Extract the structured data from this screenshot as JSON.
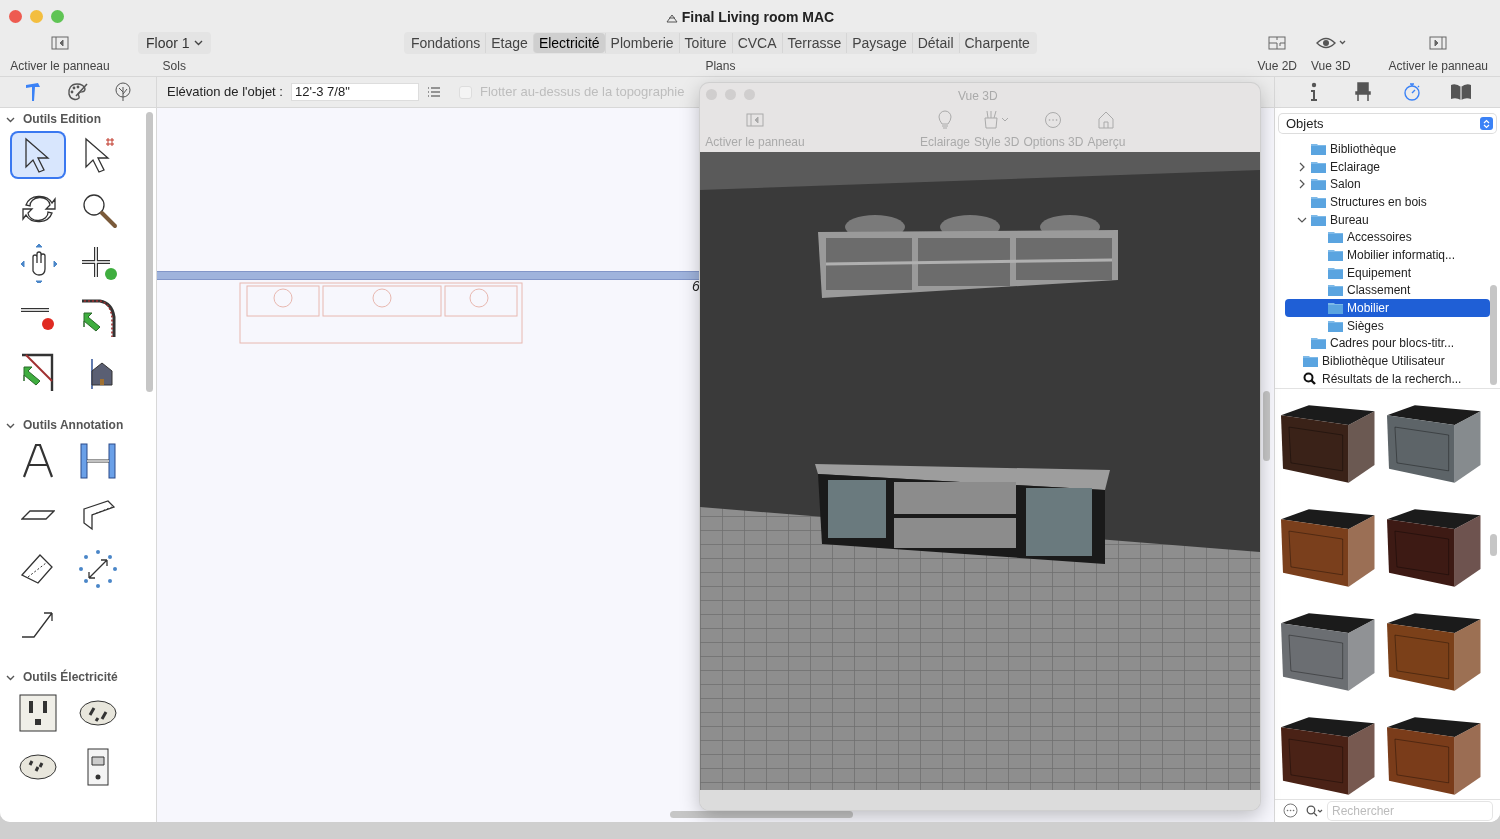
{
  "window": {
    "title": "Final Living room MAC"
  },
  "toolbar": {
    "left_button": "Activer le panneau",
    "floor": {
      "value": "Floor 1",
      "label": "Sols"
    },
    "plans_label": "Plans",
    "plans": [
      {
        "label": "Fondations",
        "selected": false
      },
      {
        "label": "Etage",
        "selected": false
      },
      {
        "label": "Electricité",
        "selected": true
      },
      {
        "label": "Plomberie",
        "selected": false
      },
      {
        "label": "Toiture",
        "selected": false
      },
      {
        "label": "CVCA",
        "selected": false
      },
      {
        "label": "Terrasse",
        "selected": false
      },
      {
        "label": "Paysage",
        "selected": false
      },
      {
        "label": "Détail",
        "selected": false
      },
      {
        "label": "Charpente",
        "selected": false
      }
    ],
    "right_buttons": [
      {
        "kind": "plan",
        "label": "Vue 2D"
      },
      {
        "kind": "eye",
        "label": "Vue 3D"
      },
      {
        "kind": "panel",
        "label": "Activer le panneau"
      }
    ]
  },
  "palette": {
    "tabs": [
      {
        "kind": "hammer",
        "selected": true
      },
      {
        "kind": "palette",
        "selected": false
      },
      {
        "kind": "tree",
        "selected": false
      }
    ],
    "sections": [
      {
        "title": "Outils Edition",
        "expanded": true,
        "tools": [
          {
            "kind": "select",
            "selected": true
          },
          {
            "kind": "select-hash",
            "selected": false
          },
          {
            "kind": "rotate",
            "selected": false
          },
          {
            "kind": "zoom",
            "selected": false
          },
          {
            "kind": "pan",
            "selected": false
          },
          {
            "kind": "add-point",
            "selected": false
          },
          {
            "kind": "remove-point",
            "selected": false
          },
          {
            "kind": "arc-corner",
            "selected": false
          },
          {
            "kind": "diag-corner",
            "selected": false
          },
          {
            "kind": "house",
            "selected": false
          }
        ]
      },
      {
        "title": "Outils Annotation",
        "expanded": true,
        "tools": [
          {
            "kind": "text",
            "selected": false
          },
          {
            "kind": "dimension",
            "selected": false
          },
          {
            "kind": "dim-line",
            "selected": false
          },
          {
            "kind": "dim-box",
            "selected": false
          },
          {
            "kind": "dim-angle",
            "selected": false
          },
          {
            "kind": "dim-circle",
            "selected": false
          },
          {
            "kind": "arrow",
            "selected": false
          }
        ]
      },
      {
        "title": "Outils Électricité",
        "expanded": true,
        "tools": [
          {
            "kind": "outlet",
            "selected": false
          },
          {
            "kind": "round-outlet",
            "selected": false
          },
          {
            "kind": "round-outlet-2",
            "selected": false
          },
          {
            "kind": "switch",
            "selected": false
          }
        ]
      }
    ]
  },
  "properties": {
    "elevation_label": "Elévation de l'objet :",
    "elevation_value": "12'-3 7/8\"",
    "float_label": "Flotter au-dessus de la topographie",
    "float_checked": false,
    "float_disabled": true
  },
  "canvas": {
    "label": "6"
  },
  "view3d": {
    "title": "Vue 3D",
    "left_button": "Activer le panneau",
    "buttons": [
      {
        "kind": "bulb",
        "label": "Eclairage"
      },
      {
        "kind": "brush",
        "label": "Style 3D"
      },
      {
        "kind": "dots",
        "label": "Options 3D"
      },
      {
        "kind": "home",
        "label": "Aperçu"
      }
    ]
  },
  "library": {
    "tabs": [
      {
        "kind": "info",
        "selected": false
      },
      {
        "kind": "chair",
        "selected": false
      },
      {
        "kind": "timer",
        "selected": true
      },
      {
        "kind": "book",
        "selected": false
      }
    ],
    "dropdown": "Objets",
    "tree": [
      {
        "label": "Bibliothèque",
        "selected": false
      },
      {
        "label": "Eclairage",
        "selected": false,
        "expanded": false
      },
      {
        "label": "Salon",
        "selected": false,
        "expanded": false
      },
      {
        "label": "Structures en bois",
        "selected": false
      },
      {
        "label": "Bureau",
        "selected": false,
        "expanded": true,
        "children": [
          {
            "label": "Accessoires",
            "selected": false
          },
          {
            "label": "Mobilier informatiq...",
            "selected": false
          },
          {
            "label": "Equipement",
            "selected": false
          },
          {
            "label": "Classement",
            "selected": false
          },
          {
            "label": "Mobilier",
            "selected": true
          },
          {
            "label": "Sièges",
            "selected": false
          }
        ]
      },
      {
        "label": "Cadres pour blocs-titr...",
        "selected": false
      }
    ],
    "root_items": [
      {
        "kind": "folder",
        "label": "Bibliothèque Utilisateur"
      },
      {
        "kind": "search",
        "label": "Résultats de la recherch..."
      }
    ],
    "thumbnails": [
      {
        "color": "#3a2218"
      },
      {
        "color": "#5d6468"
      },
      {
        "color": "#7a3f1c"
      },
      {
        "color": "#3d1a14"
      },
      {
        "color": "#6b6e72"
      },
      {
        "color": "#7b4019"
      },
      {
        "color": "#4a2216"
      },
      {
        "color": "#7a3c1a"
      }
    ],
    "search_placeholder": "Rechercher"
  }
}
